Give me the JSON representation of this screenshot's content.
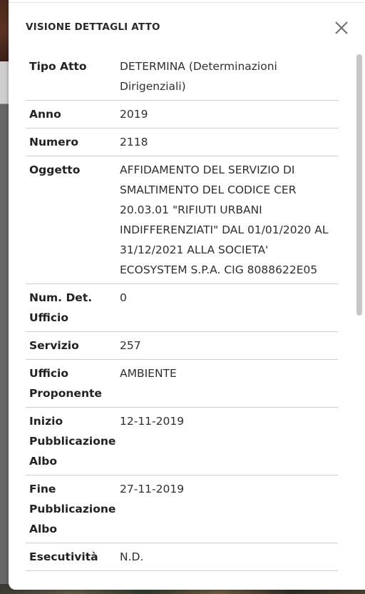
{
  "modal": {
    "title": "VISIONE DETTAGLI ATTO"
  },
  "details": [
    {
      "label": "Tipo Atto",
      "value": "DETERMINA (Determinazioni Dirigenziali)"
    },
    {
      "label": "Anno",
      "value": "2019"
    },
    {
      "label": "Numero",
      "value": "2118"
    },
    {
      "label": "Oggetto",
      "value": "AFFIDAMENTO DEL SERVIZIO DI SMALTIMENTO DEL CODICE CER 20.03.01 \"RIFIUTI URBANI INDIFFERENZIATI\" DAL 01/01/2020 AL 31/12/2021 ALLA SOCIETA' ECOSYSTEM S.P.A. CIG 8088622E05"
    },
    {
      "label": "Num. Det. Ufficio",
      "value": "0"
    },
    {
      "label": "Servizio",
      "value": "257"
    },
    {
      "label": "Ufficio Proponente",
      "value": "AMBIENTE"
    },
    {
      "label": "Inizio Pubblicazione Albo",
      "value": "12-11-2019"
    },
    {
      "label": "Fine Pubblicazione Albo",
      "value": "27-11-2019"
    },
    {
      "label": "Esecutività",
      "value": "N.D."
    }
  ],
  "icons": {
    "close": "close-icon"
  }
}
